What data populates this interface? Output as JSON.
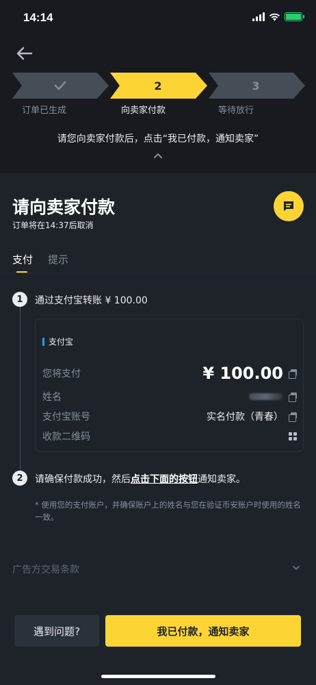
{
  "status_bar": {
    "time": "14:14"
  },
  "steps": [
    {
      "number": "",
      "label": "订单已生成",
      "state": "done"
    },
    {
      "number": "2",
      "label": "向卖家付款",
      "state": "active"
    },
    {
      "number": "3",
      "label": "等待放行",
      "state": "pending"
    }
  ],
  "hint": "请您向卖家付款后，点击“我已付款，通知卖家”",
  "header": {
    "title": "请向卖家付款",
    "subtitle": "订单将在14:37后取消"
  },
  "tabs": {
    "pay": "支付",
    "tips": "提示"
  },
  "instructions": {
    "step1_num": "1",
    "step1_text": "通过支付宝转账 ¥ 100.00",
    "step2_num": "2",
    "step2_pre": "请确保付款成功，然后",
    "step2_link": "点击下面的按钮",
    "step2_post": "通知卖家。",
    "note": "* 使用您的支付账户，并确保账户上的姓名与您在验证币安账户时使用的姓名一致。"
  },
  "payment_card": {
    "method": "支付宝",
    "amount_label": "您将支付",
    "amount_value": "¥ 100.00",
    "name_label": "姓名",
    "account_label": "支付宝账号",
    "account_value": "实名付款（青春）",
    "qr_label": "收款二维码"
  },
  "terms": {
    "label": "广告方交易条款"
  },
  "buttons": {
    "problem": "遇到问题?",
    "paid": "我已付款，通知卖家"
  },
  "colors": {
    "accent": "#fcd535",
    "background": "#1e2329",
    "top_background": "#181a20",
    "secondary_text": "#848e9c",
    "alipay_blue": "#1da1f2",
    "battery_green": "#2ecc71"
  }
}
